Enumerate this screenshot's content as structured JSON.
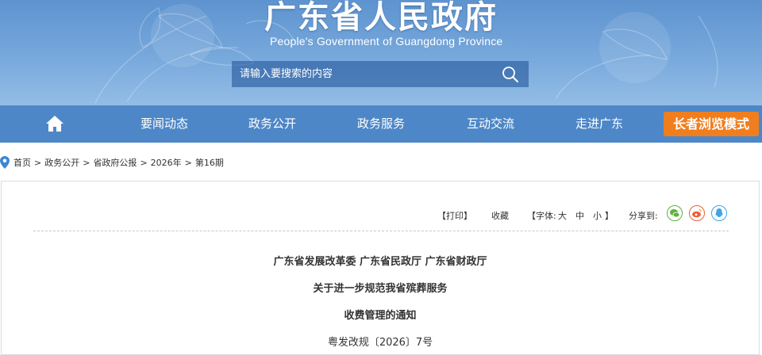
{
  "header": {
    "title": "广东省人民政府",
    "subtitle": "People's Government of Guangdong Province",
    "search": {
      "placeholder": "请输入要搜索的内容"
    }
  },
  "nav": {
    "home_icon": "home-icon",
    "items": [
      "要闻动态",
      "政务公开",
      "政务服务",
      "互动交流",
      "走进广东"
    ],
    "elder_mode": "长者浏览模式"
  },
  "breadcrumb": [
    "首页",
    "政务公开",
    "省政府公报",
    "2026年",
    "第16期"
  ],
  "tools": {
    "print": "【打印】",
    "favorite": "收藏",
    "font_prefix": "【字体:",
    "font_large": "大",
    "font_medium": "中",
    "font_small": "小",
    "font_suffix": "】",
    "share_label": "分享到:",
    "share_icons": [
      "wechat-icon",
      "weibo-icon",
      "qq-icon"
    ]
  },
  "document": {
    "issuers": "广东省发展改革委 广东省民政厅 广东省财政厅",
    "title_line1": "关于进一步规范我省殡葬服务",
    "title_line2": "收费管理的通知",
    "doc_number": "粤发改规〔2026〕7号"
  },
  "colors": {
    "nav_bg": "#4e87c7",
    "elder_mode_bg": "#f07e1e",
    "wechat": "#5bb33a",
    "weibo": "#e9603a",
    "qq": "#3fa6e5"
  }
}
